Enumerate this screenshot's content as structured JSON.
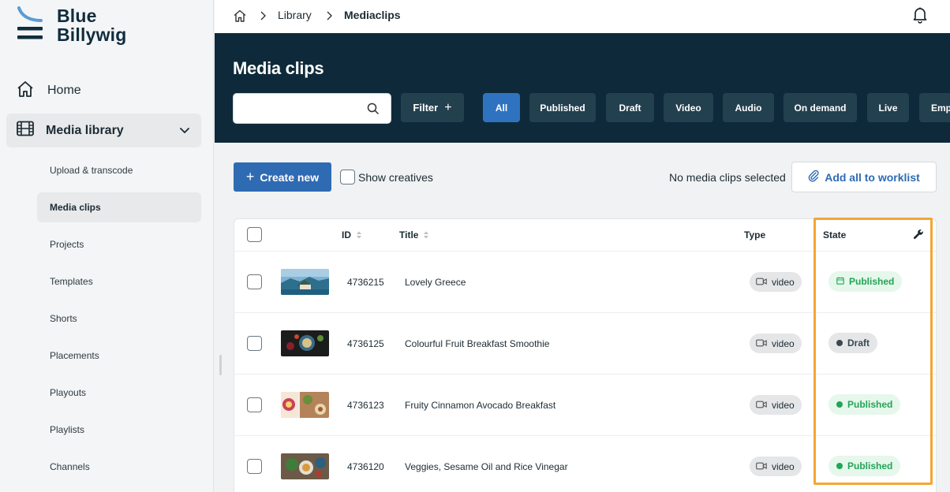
{
  "brand": {
    "line1": "Blue",
    "line2": "Billywig"
  },
  "sidebar": {
    "home_label": "Home",
    "media_library_label": "Media library",
    "items": [
      {
        "label": "Upload & transcode",
        "active": false
      },
      {
        "label": "Media clips",
        "active": true
      },
      {
        "label": "Projects",
        "active": false
      },
      {
        "label": "Templates",
        "active": false
      },
      {
        "label": "Shorts",
        "active": false
      },
      {
        "label": "Placements",
        "active": false
      },
      {
        "label": "Playouts",
        "active": false
      },
      {
        "label": "Playlists",
        "active": false
      },
      {
        "label": "Channels",
        "active": false
      }
    ]
  },
  "breadcrumb": {
    "library": "Library",
    "current": "Mediaclips"
  },
  "header": {
    "title": "Media clips",
    "search_value": "",
    "search_placeholder": "",
    "filter_label": "Filter",
    "chips": [
      "All",
      "Published",
      "Draft",
      "Video",
      "Audio",
      "On demand",
      "Live",
      "Emp"
    ],
    "active_chip": "All"
  },
  "actions": {
    "create_label": "Create new",
    "show_creatives_label": "Show creatives",
    "selection_status": "No media clips selected",
    "worklist_label": "Add all to worklist"
  },
  "table": {
    "columns": {
      "id": "ID",
      "title": "Title",
      "type": "Type",
      "state": "State"
    },
    "rows": [
      {
        "id": "4736215",
        "title": "Lovely Greece",
        "type": "video",
        "state": "Published",
        "state_kind": "published-scheduled"
      },
      {
        "id": "4736125",
        "title": "Colourful Fruit Breakfast Smoothie",
        "type": "video",
        "state": "Draft",
        "state_kind": "draft"
      },
      {
        "id": "4736123",
        "title": "Fruity Cinnamon Avocado Breakfast",
        "type": "video",
        "state": "Published",
        "state_kind": "published"
      },
      {
        "id": "4736120",
        "title": "Veggies, Sesame Oil and Rice Vinegar",
        "type": "video",
        "state": "Published",
        "state_kind": "published"
      }
    ]
  },
  "colors": {
    "header_bg": "#0e2a3a",
    "chip_bg": "#23404f",
    "chip_active": "#2f73c0",
    "primary": "#2f6bb3",
    "published_green": "#22a555",
    "highlight_orange": "#f5a534"
  },
  "icons": {
    "home": "home-icon",
    "media_library": "film-icon",
    "chevron": "chevron-down-icon",
    "bell": "bell-icon",
    "search": "search-icon",
    "paperclip": "paperclip-icon",
    "wrench": "wrench-icon",
    "video": "video-camera-icon",
    "calendar": "calendar-icon"
  }
}
